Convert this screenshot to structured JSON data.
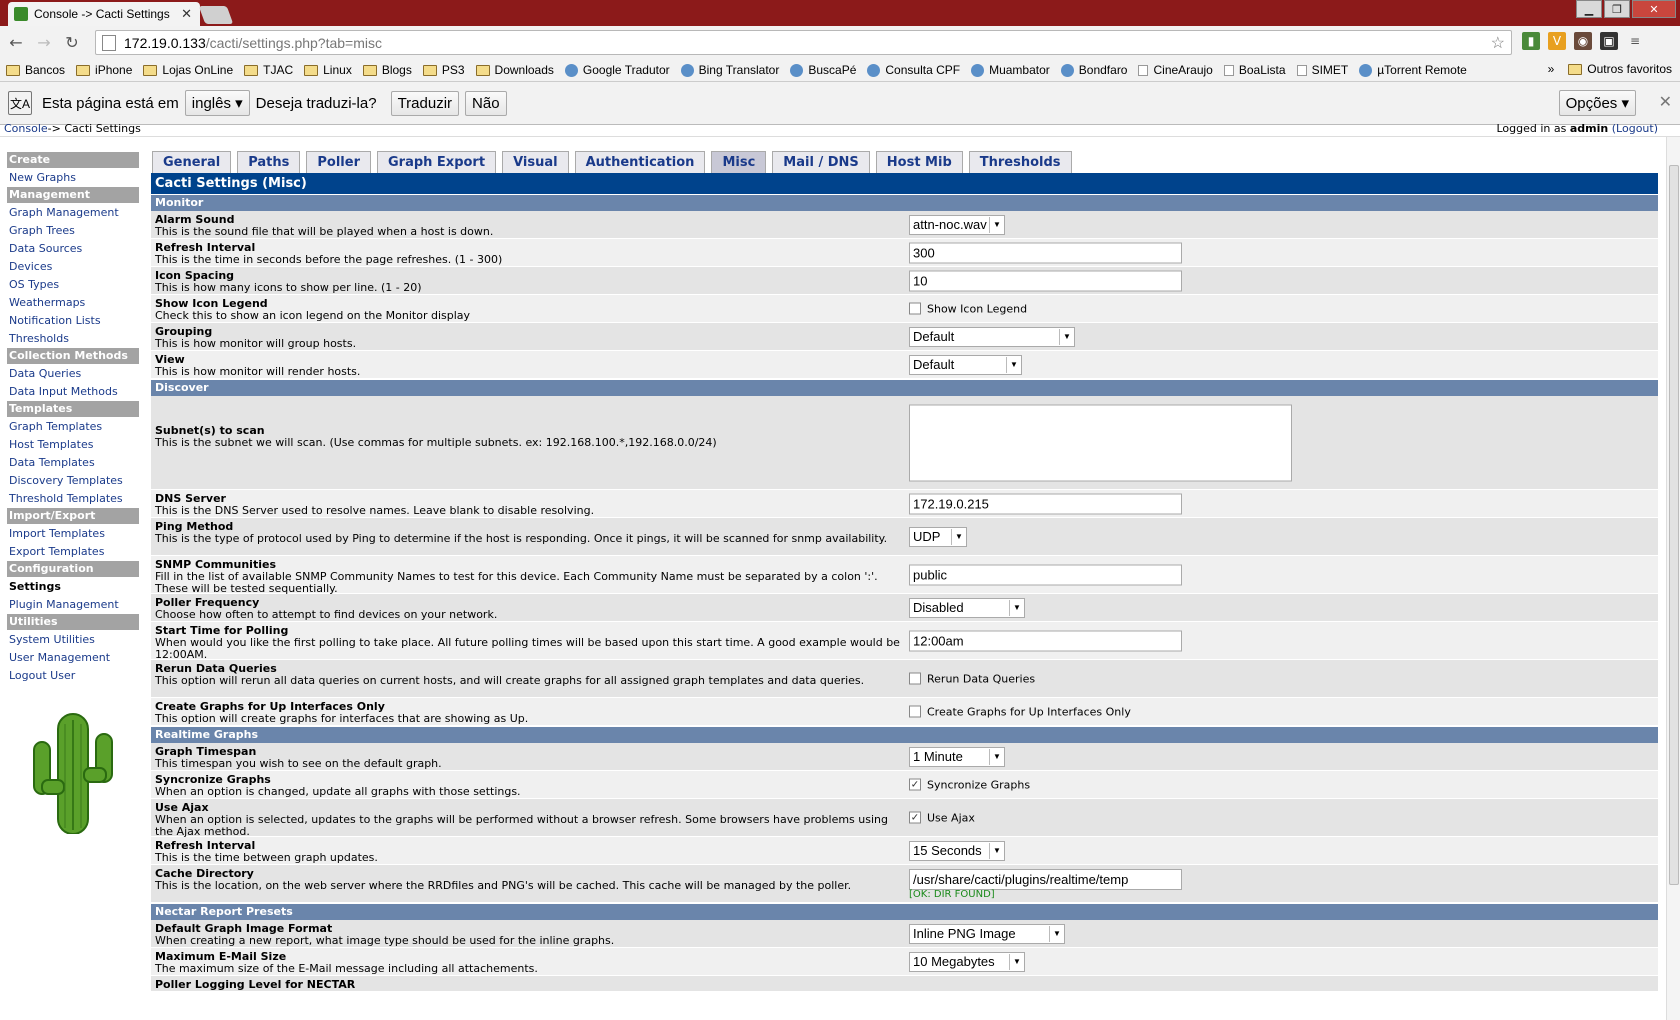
{
  "browser": {
    "tab_title": "Console -> Cacti Settings",
    "url_host": "172.19.0.133",
    "url_path": "/cacti/settings.php?tab=misc",
    "bookmarks": [
      "Bancos",
      "iPhone",
      "Lojas OnLine",
      "TJAC",
      "Linux",
      "Blogs",
      "PS3",
      "Downloads",
      "Google Tradutor",
      "Bing Translator",
      "BuscaPé",
      "Consulta CPF",
      "Muambator",
      "Bondfaro",
      "CineAraujo",
      "BoaLista",
      "SIMET",
      "µTorrent Remote"
    ],
    "bookmarks_more": "»",
    "other_bookmarks": "Outros favoritos"
  },
  "translate": {
    "prefix": "Esta página está em",
    "lang": "inglês",
    "question": "Deseja traduzi-la?",
    "translate_btn": "Traduzir",
    "no_btn": "Não",
    "options": "Opções"
  },
  "breadcrumb": {
    "console": "Console",
    "rest": " -> Cacti Settings",
    "logged_prefix": "Logged in as ",
    "user": "admin",
    "logout": "(Logout)"
  },
  "sidebar": [
    {
      "type": "h",
      "label": "Create"
    },
    {
      "type": "i",
      "label": "New Graphs"
    },
    {
      "type": "h",
      "label": "Management"
    },
    {
      "type": "i",
      "label": "Graph Management"
    },
    {
      "type": "i",
      "label": "Graph Trees"
    },
    {
      "type": "i",
      "label": "Data Sources"
    },
    {
      "type": "i",
      "label": "Devices"
    },
    {
      "type": "i",
      "label": "OS Types"
    },
    {
      "type": "i",
      "label": "Weathermaps"
    },
    {
      "type": "i",
      "label": "Notification Lists"
    },
    {
      "type": "i",
      "label": "Thresholds"
    },
    {
      "type": "h",
      "label": "Collection Methods"
    },
    {
      "type": "i",
      "label": "Data Queries"
    },
    {
      "type": "i",
      "label": "Data Input Methods"
    },
    {
      "type": "h",
      "label": "Templates"
    },
    {
      "type": "i",
      "label": "Graph Templates"
    },
    {
      "type": "i",
      "label": "Host Templates"
    },
    {
      "type": "i",
      "label": "Data Templates"
    },
    {
      "type": "i",
      "label": "Discovery Templates"
    },
    {
      "type": "i",
      "label": "Threshold Templates"
    },
    {
      "type": "h",
      "label": "Import/Export"
    },
    {
      "type": "i",
      "label": "Import Templates"
    },
    {
      "type": "i",
      "label": "Export Templates"
    },
    {
      "type": "h",
      "label": "Configuration"
    },
    {
      "type": "c",
      "label": "Settings"
    },
    {
      "type": "i",
      "label": "Plugin Management"
    },
    {
      "type": "h",
      "label": "Utilities"
    },
    {
      "type": "i",
      "label": "System Utilities"
    },
    {
      "type": "i",
      "label": "User Management"
    },
    {
      "type": "i",
      "label": "Logout User"
    }
  ],
  "tabs": [
    "General",
    "Paths",
    "Poller",
    "Graph Export",
    "Visual",
    "Authentication",
    "Misc",
    "Mail / DNS",
    "Host Mib",
    "Thresholds"
  ],
  "active_tab": "Misc",
  "title": "Cacti Settings (Misc)",
  "sections": [
    {
      "name": "Monitor",
      "rows": [
        {
          "t": "Alarm Sound",
          "d": "This is the sound file that will be played when a host is down.",
          "k": "select",
          "v": "attn-noc.wav",
          "w": 96
        },
        {
          "t": "Refresh Interval",
          "d": "This is the time in seconds before the page refreshes. (1 - 300)",
          "k": "text",
          "v": "300"
        },
        {
          "t": "Icon Spacing",
          "d": "This is how many icons to show per line. (1 - 20)",
          "k": "text",
          "v": "10"
        },
        {
          "t": "Show Icon Legend",
          "d": "Check this to show an icon legend on the Monitor display",
          "k": "check",
          "v": "Show Icon Legend",
          "c": false
        },
        {
          "t": "Grouping",
          "d": "This is how monitor will group hosts.",
          "k": "select",
          "v": "Default",
          "w": 166
        },
        {
          "t": "View",
          "d": "This is how monitor will render hosts.",
          "k": "select",
          "v": "Default",
          "w": 113
        }
      ]
    },
    {
      "name": "Discover",
      "rows": [
        {
          "t": "Subnet(s) to scan",
          "d": "This is the subnet we will scan. (Use commas for multiple subnets. ex: 192.168.100.*,192.168.0.0/24)",
          "k": "area",
          "v": ""
        },
        {
          "t": "DNS Server",
          "d": "This is the DNS Server used to resolve names. Leave blank to disable resolving.",
          "k": "text",
          "v": "172.19.0.215"
        },
        {
          "t": "Ping Method",
          "d": "This is the type of protocol used by Ping to determine if the host is responding. Once it pings, it will be scanned for snmp availability.",
          "k": "select",
          "v": "UDP",
          "w": 58
        },
        {
          "t": "SNMP Communities",
          "d": "Fill in the list of available SNMP Community Names to test for this device. Each Community Name must be separated by a colon ':'. These will be tested sequentially.",
          "k": "text",
          "v": "public"
        },
        {
          "t": "Poller Frequency",
          "d": "Choose how often to attempt to find devices on your network.",
          "k": "select",
          "v": "Disabled",
          "w": 116
        },
        {
          "t": "Start Time for Polling",
          "d": "When would you like the first polling to take place. All future polling times will be based upon this start time. A good example would be 12:00AM.",
          "k": "text",
          "v": "12:00am"
        },
        {
          "t": "Rerun Data Queries",
          "d": "This option will rerun all data queries on current hosts, and will create graphs for all assigned graph templates and data queries.",
          "k": "check",
          "v": "Rerun Data Queries",
          "c": false
        },
        {
          "t": "Create Graphs for Up Interfaces Only",
          "d": "This option will create graphs for interfaces that are showing as Up.",
          "k": "check",
          "v": "Create Graphs for Up Interfaces Only",
          "c": false
        }
      ]
    },
    {
      "name": "Realtime Graphs",
      "rows": [
        {
          "t": "Graph Timespan",
          "d": "This timespan you wish to see on the default graph.",
          "k": "select",
          "v": "1 Minute",
          "w": 96
        },
        {
          "t": "Syncronize Graphs",
          "d": "When an option is changed, update all graphs with those settings.",
          "k": "check",
          "v": "Syncronize Graphs",
          "c": true
        },
        {
          "t": "Use Ajax",
          "d": "When an option is selected, updates to the graphs will be performed without a browser refresh. Some browsers have problems using the Ajax method.",
          "k": "check",
          "v": "Use Ajax",
          "c": true
        },
        {
          "t": "Refresh Interval",
          "d": "This is the time between graph updates.",
          "k": "select",
          "v": "15 Seconds",
          "w": 96
        },
        {
          "t": "Cache Directory",
          "d": "This is the location, on the web server where the RRDfiles and PNG's will be cached. This cache will be managed by the poller.",
          "k": "text",
          "v": "/usr/share/cacti/plugins/realtime/temp",
          "ok": "[OK: DIR FOUND]"
        }
      ]
    },
    {
      "name": "Nectar Report Presets",
      "rows": [
        {
          "t": "Default Graph Image Format",
          "d": "When creating a new report, what image type should be used for the inline graphs.",
          "k": "select",
          "v": "Inline PNG Image",
          "w": 156
        },
        {
          "t": "Maximum E-Mail Size",
          "d": "The maximum size of the E-Mail message including all attachements.",
          "k": "select",
          "v": "10 Megabytes",
          "w": 116
        },
        {
          "t": "Poller Logging Level for NECTAR",
          "d": "",
          "k": "none",
          "v": ""
        }
      ]
    }
  ]
}
